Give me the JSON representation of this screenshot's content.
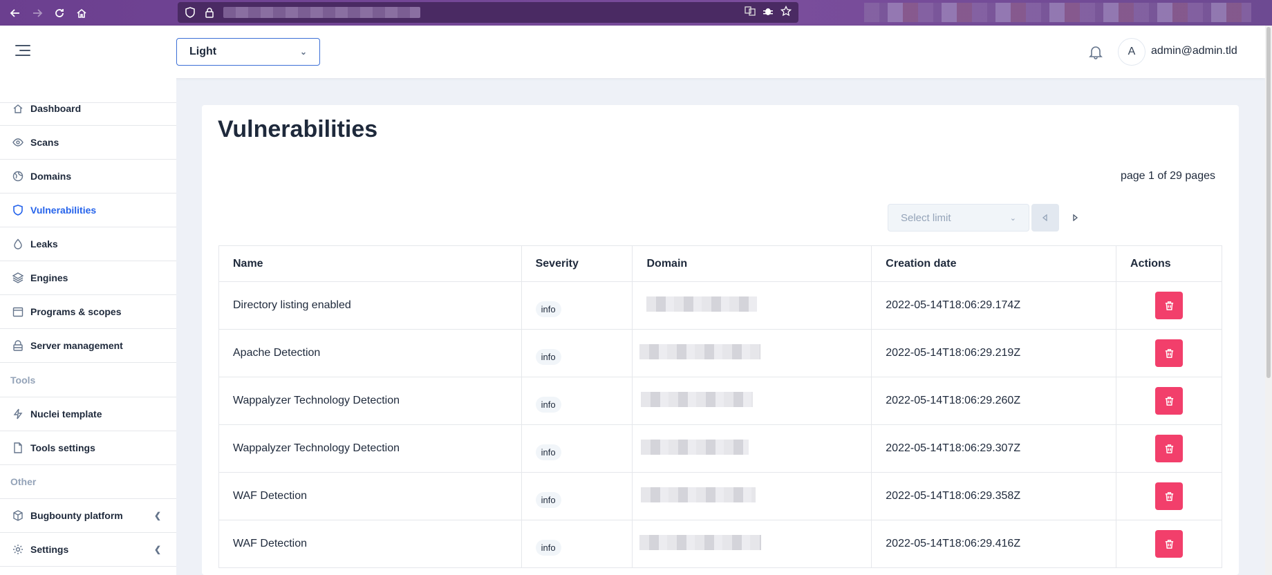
{
  "browser": {
    "back_icon": "arrow-left-icon",
    "forward_icon": "arrow-right-icon",
    "reload_icon": "reload-icon",
    "home_icon": "home-icon"
  },
  "header": {
    "theme_value": "Light",
    "avatar_initial": "A",
    "user_email": "admin@admin.tld"
  },
  "sidebar": {
    "items": [
      {
        "label": "Dashboard",
        "icon": "home-icon"
      },
      {
        "label": "Scans",
        "icon": "eye-icon"
      },
      {
        "label": "Domains",
        "icon": "globe-icon"
      },
      {
        "label": "Vulnerabilities",
        "icon": "shield-icon",
        "active": true
      },
      {
        "label": "Leaks",
        "icon": "droplet-icon"
      },
      {
        "label": "Engines",
        "icon": "layers-icon"
      },
      {
        "label": "Programs & scopes",
        "icon": "calendar-icon"
      },
      {
        "label": "Server management",
        "icon": "lock-icon"
      }
    ],
    "tools_title": "Tools",
    "tools": [
      {
        "label": "Nuclei template",
        "icon": "bolt-icon"
      },
      {
        "label": "Tools settings",
        "icon": "file-icon"
      }
    ],
    "other_title": "Other",
    "other": [
      {
        "label": "Bugbounty platform",
        "icon": "box-icon"
      },
      {
        "label": "Settings",
        "icon": "gear-icon"
      }
    ]
  },
  "main": {
    "title": "Vulnerabilities",
    "page_info": "page 1 of 29 pages",
    "limit_placeholder": "Select limit",
    "columns": [
      "Name",
      "Severity",
      "Domain",
      "Creation date",
      "Actions"
    ],
    "rows": [
      {
        "name": "Directory listing enabled",
        "severity": "info",
        "date": "2022-05-14T18:06:29.174Z"
      },
      {
        "name": "Apache Detection",
        "severity": "info",
        "date": "2022-05-14T18:06:29.219Z"
      },
      {
        "name": "Wappalyzer Technology Detection",
        "severity": "info",
        "date": "2022-05-14T18:06:29.260Z"
      },
      {
        "name": "Wappalyzer Technology Detection",
        "severity": "info",
        "date": "2022-05-14T18:06:29.307Z"
      },
      {
        "name": "WAF Detection",
        "severity": "info",
        "date": "2022-05-14T18:06:29.358Z"
      },
      {
        "name": "WAF Detection",
        "severity": "info",
        "date": "2022-05-14T18:06:29.416Z"
      }
    ]
  },
  "colors": {
    "accent": "#2563eb",
    "delete": "#f23f6b",
    "browser_bar": "#6b3f8f"
  }
}
